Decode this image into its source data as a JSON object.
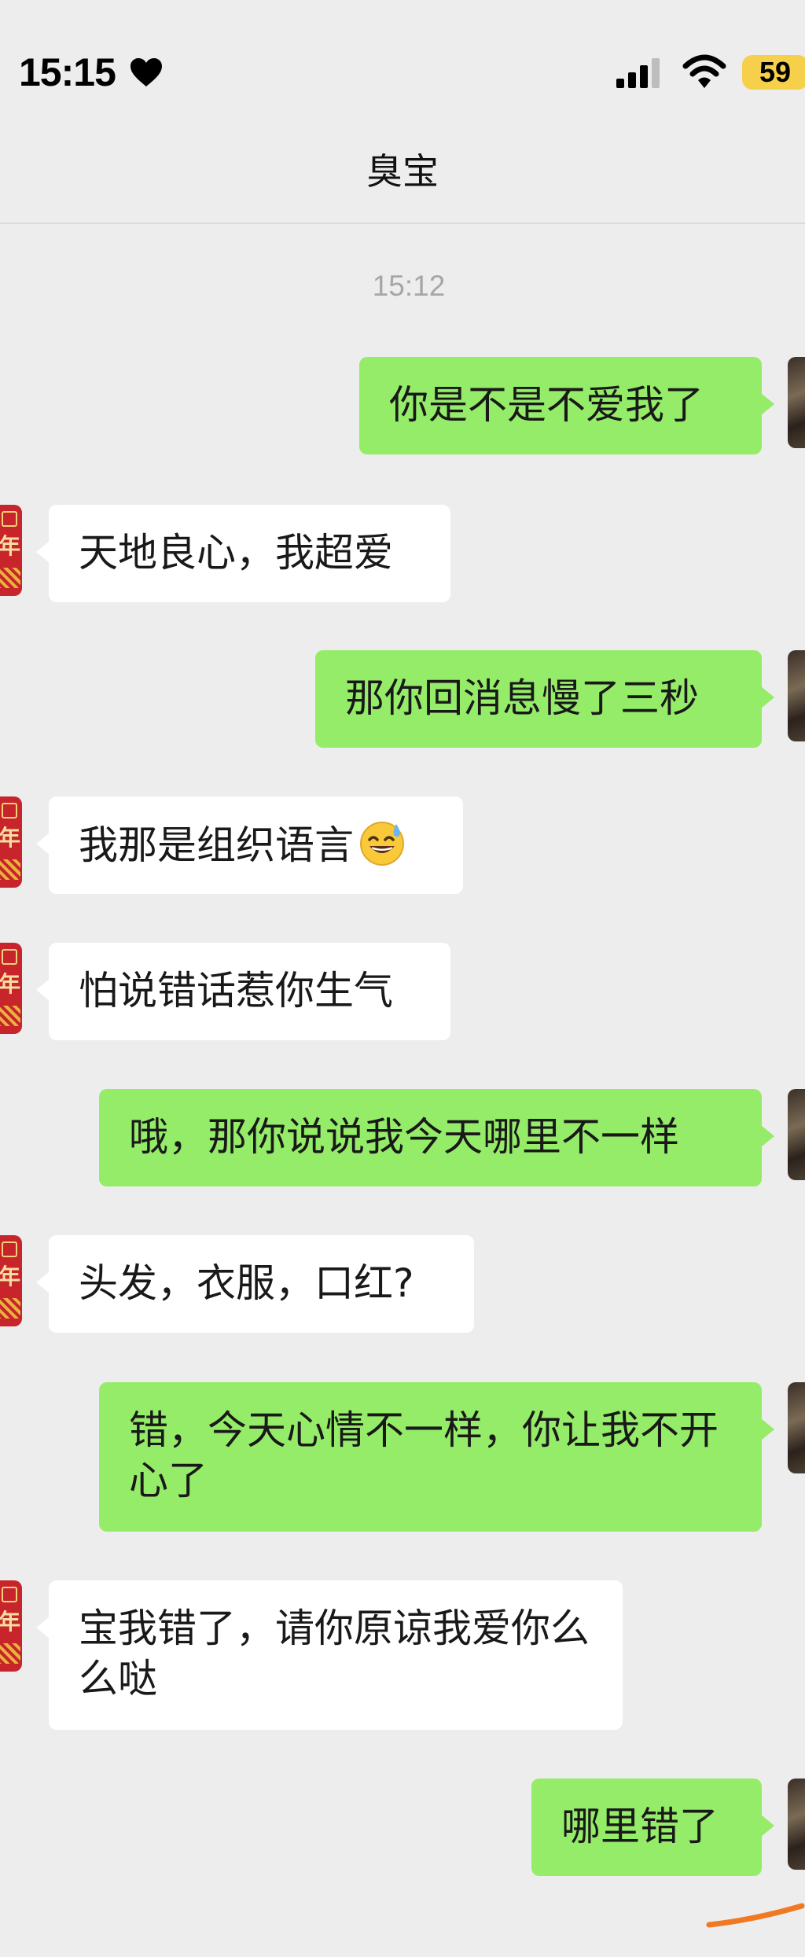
{
  "status_bar": {
    "time": "15:15",
    "battery_level": "59",
    "icons": [
      "heart-icon",
      "signal-icon",
      "wifi-icon",
      "battery-icon"
    ],
    "battery_color": "#f6d04b"
  },
  "header": {
    "title": "臭宝"
  },
  "chat": {
    "timestamp": "15:12",
    "colors": {
      "outgoing_bubble": "#95ec69",
      "incoming_bubble": "#ffffff",
      "background": "#ededed"
    },
    "messages": [
      {
        "side": "out",
        "text": "你是不是不爱我了"
      },
      {
        "side": "in",
        "text": "天地良心，我超爱"
      },
      {
        "side": "out",
        "text": "那你回消息慢了三秒"
      },
      {
        "side": "in",
        "text": "我那是组织语言",
        "emoji": "sweat-smile-emoji-icon"
      },
      {
        "side": "in",
        "text": "怕说错话惹你生气"
      },
      {
        "side": "out",
        "text": "哦，那你说说我今天哪里不一样"
      },
      {
        "side": "in",
        "text": "头发，衣服，口红?"
      },
      {
        "side": "out",
        "text": "错，今天心情不一样，你让我不开心了"
      },
      {
        "side": "in",
        "text": "宝我错了，请你原谅我爱你么么哒"
      },
      {
        "side": "out",
        "text": "哪里错了"
      }
    ],
    "left_avatar_char": "年"
  }
}
